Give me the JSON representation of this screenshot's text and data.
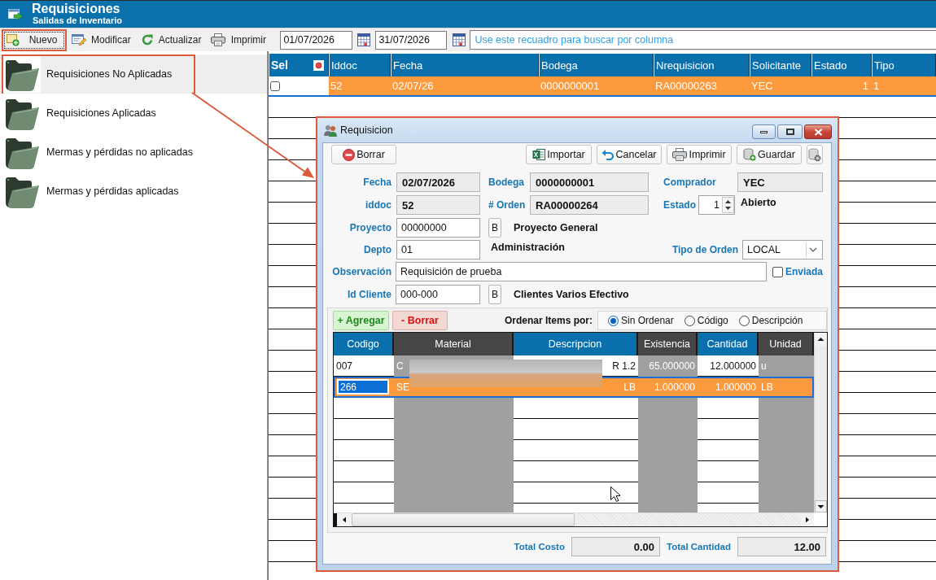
{
  "header": {
    "title": "Requisiciones",
    "subtitle": "Salidas de Inventario"
  },
  "toolbar": {
    "buttons": [
      {
        "kind": "new",
        "label": "Nuevo",
        "focused": true,
        "highlighted": true
      },
      {
        "kind": "edit",
        "label": "Modificar",
        "focused": false,
        "highlighted": false
      },
      {
        "kind": "refresh",
        "label": "Actualizar",
        "focused": false,
        "highlighted": false
      },
      {
        "kind": "print",
        "label": "Imprimir",
        "focused": false,
        "highlighted": false
      }
    ],
    "date_from": "01/07/2026",
    "date_to": "31/07/2026",
    "search": {
      "placeholder": "Use este recuadro para buscar por columna"
    }
  },
  "sidebar": {
    "items": [
      {
        "label": "Requisiciones No Aplicadas",
        "selected": true,
        "highlighted": true
      },
      {
        "label": "Requisiciones Aplicadas",
        "selected": false,
        "highlighted": false
      },
      {
        "label": "Mermas y pérdidas no aplicadas",
        "selected": false,
        "highlighted": false
      },
      {
        "label": "Mermas y pérdidas aplicadas",
        "selected": false,
        "highlighted": false
      }
    ]
  },
  "table": {
    "columns": [
      "Sel",
      "Iddoc",
      "Fecha",
      "Bodega",
      "Nrequisicion",
      "Solicitante",
      "Estado",
      "Tipo"
    ],
    "rows": [
      {
        "selected": true,
        "checked": false,
        "cells": [
          "",
          "52",
          "02/07/26",
          "0000000001",
          "RA00000263",
          "YEC",
          "1",
          "1"
        ]
      }
    ]
  },
  "dialog": {
    "title": "Requisicion",
    "highlighted": true,
    "toolbar": {
      "left": [
        {
          "kind": "delete",
          "label": "Borrar"
        }
      ],
      "right": [
        {
          "kind": "excel",
          "label": "Importar"
        },
        {
          "kind": "undo",
          "label": "Cancelar"
        },
        {
          "kind": "print",
          "label": "Imprimir"
        },
        {
          "kind": "save",
          "label": "Guardar"
        },
        {
          "kind": "settings"
        }
      ]
    },
    "form": {
      "fecha": {
        "label": "Fecha",
        "value": "02/07/2026"
      },
      "bodega": {
        "label": "Bodega",
        "value": "0000000001"
      },
      "comprador": {
        "label": "Comprador",
        "value": "YEC"
      },
      "iddoc": {
        "label": "iddoc",
        "value": "52"
      },
      "orden": {
        "label": "# Orden",
        "value": "RA00000264"
      },
      "estado": {
        "label": "Estado",
        "value": "1",
        "description": "Abierto"
      },
      "proyecto": {
        "label": "Proyecto",
        "value": "00000000",
        "button": "B",
        "description": "Proyecto General"
      },
      "depto": {
        "label": "Depto",
        "value": "01",
        "description": "Administración"
      },
      "tipo_orden": {
        "label": "Tipo de Orden",
        "value": "LOCAL"
      },
      "observacion": {
        "label": "Observación",
        "value": "Requisición de prueba"
      },
      "enviada": {
        "label": "Enviada",
        "checked": false
      },
      "id_cliente": {
        "label": "Id Cliente",
        "value": "000-000",
        "button": "B",
        "description": "Clientes Varios Efectivo"
      }
    },
    "items": {
      "buttons": [
        {
          "kind": "add",
          "label": "+ Agregar"
        },
        {
          "kind": "remove",
          "label": "- Borrar"
        }
      ],
      "sort": {
        "label": "Ordenar Items por:",
        "options": [
          {
            "label": "Sin Ordenar",
            "selected": true
          },
          {
            "label": "Código",
            "selected": false
          },
          {
            "label": "Descripción",
            "selected": false
          }
        ]
      },
      "columns": [
        {
          "label": "Codigo",
          "editable": true
        },
        {
          "label": "Material",
          "editable": false
        },
        {
          "label": "Descripcion",
          "editable": true
        },
        {
          "label": "Existencia",
          "editable": false
        },
        {
          "label": "Cantidad",
          "editable": true
        },
        {
          "label": "Unidad",
          "editable": false
        }
      ],
      "rows": [
        {
          "selected": false,
          "editing": false,
          "cells": [
            "007",
            "C",
            "R 1.2",
            "65.000000",
            "12.000000",
            "u"
          ]
        },
        {
          "selected": true,
          "editing": true,
          "cells": [
            "266",
            "SE",
            "LB",
            "1.000000",
            "1.000000",
            "LB"
          ]
        }
      ]
    },
    "totals": [
      {
        "label": "Total Costo",
        "value": "0.00"
      },
      {
        "label": "Total Cantidad",
        "value": "12.00"
      }
    ]
  }
}
